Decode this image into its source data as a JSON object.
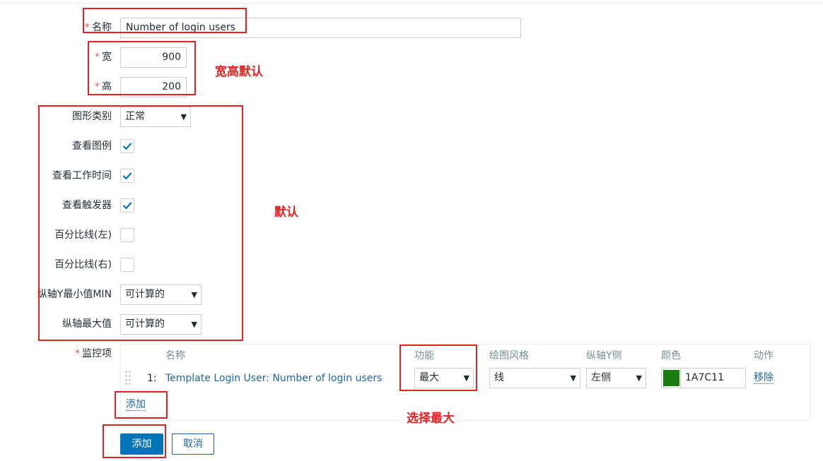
{
  "form": {
    "required_mark": "*",
    "name": {
      "label": "名称",
      "value": "Number of login users"
    },
    "width": {
      "label": "宽",
      "value": "900"
    },
    "height": {
      "label": "高",
      "value": "200"
    },
    "graph_type": {
      "label": "图形类别",
      "value": "正常"
    },
    "show_legend": {
      "label": "查看图例",
      "checked": true
    },
    "show_working_time": {
      "label": "查看工作时间",
      "checked": true
    },
    "show_triggers": {
      "label": "查看触发器",
      "checked": true
    },
    "percentile_left": {
      "label": "百分比线(左)",
      "checked": false
    },
    "percentile_right": {
      "label": "百分比线(右)",
      "checked": false
    },
    "y_min": {
      "label": "纵轴Y最小值MIN",
      "value": "可计算的"
    },
    "y_max": {
      "label": "纵轴最大值",
      "value": "可计算的"
    },
    "items": {
      "label": "监控项",
      "headers": [
        "名称",
        "功能",
        "绘图风格",
        "纵轴Y侧",
        "颜色",
        "动作"
      ],
      "rows": [
        {
          "index": "1:",
          "name": "Template Login User: Number of login users",
          "function": "最大",
          "draw_style": "线",
          "y_side": "左侧",
          "color": "1A7C11",
          "color_hex": "#1a7c11",
          "action": "移除"
        }
      ],
      "add_link": "添加"
    },
    "buttons": {
      "submit": "添加",
      "cancel": "取消"
    }
  },
  "annotations": {
    "size_default": "宽高默认",
    "default": "默认",
    "choose_max": "选择最大"
  },
  "colors": {
    "annotation_red": "#e52222",
    "primary_blue": "#0275b8",
    "link_blue": "#1f65a6",
    "check_blue": "#0275b8"
  },
  "icons": {
    "checkbox_check": "check-icon",
    "dropdown": "chevron-down-icon",
    "drag": "drag-handle-icon"
  }
}
